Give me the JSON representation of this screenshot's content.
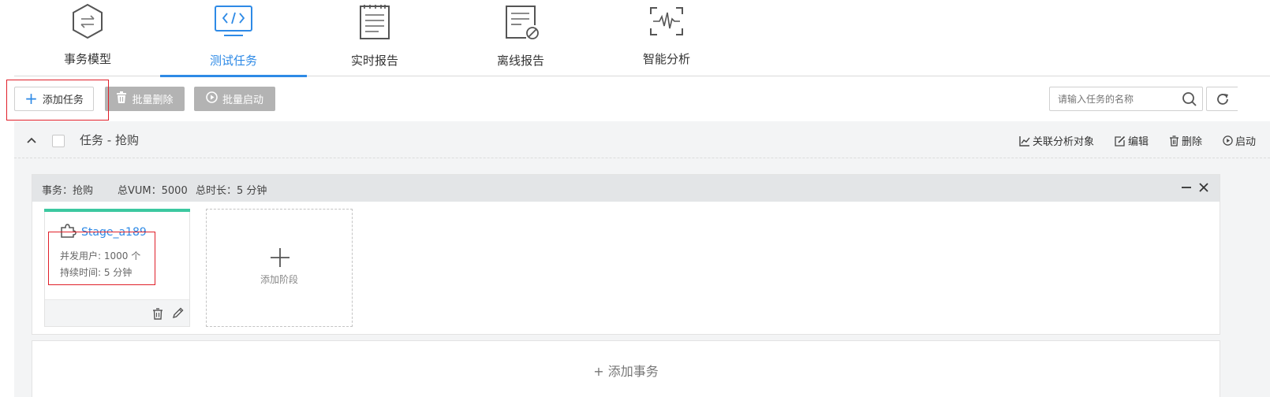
{
  "nav": {
    "items": [
      {
        "label": "事务模型",
        "icon": "hexagon-transfer-icon",
        "active": false
      },
      {
        "label": "测试任务",
        "icon": "code-monitor-icon",
        "active": true
      },
      {
        "label": "实时报告",
        "icon": "notepad-icon",
        "active": false
      },
      {
        "label": "离线报告",
        "icon": "document-blocked-icon",
        "active": false
      },
      {
        "label": "智能分析",
        "icon": "waveform-scan-icon",
        "active": false
      }
    ]
  },
  "toolbar": {
    "add_task": "添加任务",
    "batch_delete": "批量删除",
    "batch_start": "批量启动",
    "search_placeholder": "请输入任务的名称"
  },
  "task": {
    "title": "任务 - 抢购",
    "actions": {
      "link_analysis": "关联分析对象",
      "edit": "编辑",
      "delete": "删除",
      "start": "启动"
    }
  },
  "transaction": {
    "name": "事务：抢购",
    "total_vum": "总VUM：5000",
    "total_duration": "总时长：5 分钟",
    "stage": {
      "name": "Stage_a189",
      "concurrent_users": "并发用户: 1000 个",
      "duration": "持续时间: 5 分钟"
    },
    "add_stage": "添加阶段"
  },
  "add_transaction": "+ 添加事务",
  "colors": {
    "accent": "#2e8ae6",
    "stage_bar": "#3cc8a0",
    "highlight": "#e0202a",
    "button_gray": "#b3b3b3"
  }
}
